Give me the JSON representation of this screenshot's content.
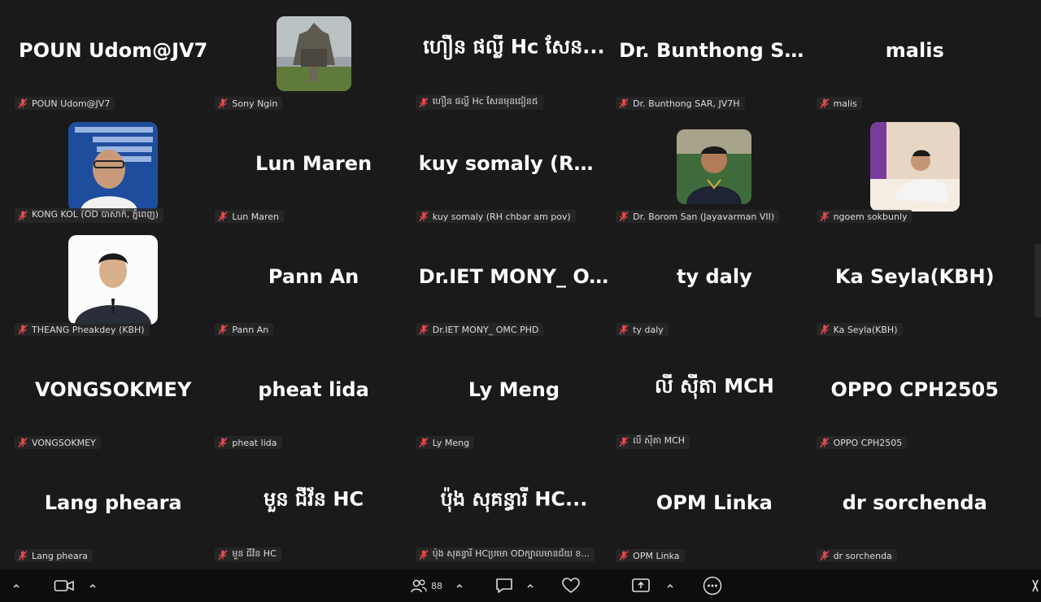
{
  "participants": [
    {
      "big": "POUN Udom@JV7",
      "label": "POUN Udom@JV7",
      "avatar": null
    },
    {
      "big": "",
      "label": "Sony Ngin",
      "avatar": "temple"
    },
    {
      "big": "ហឿន ផល្លី Hc សែន...",
      "label": "ហឿន ផល្លី Hc សែនមុនជៀន៥",
      "avatar": null
    },
    {
      "big": "Dr. Bunthong SA...",
      "label": "Dr. Bunthong SAR, JV7H",
      "avatar": null
    },
    {
      "big": "malis",
      "label": "malis",
      "avatar": null
    },
    {
      "big": "",
      "label": "KONG KOL (OD បាសាក់, ភ្នំពេញ)",
      "avatar": "presenter"
    },
    {
      "big": "Lun Maren",
      "label": "Lun Maren",
      "avatar": null
    },
    {
      "big": "kuy somaly (RH...",
      "label": "kuy somaly (RH chbar am pov)",
      "avatar": null
    },
    {
      "big": "",
      "label": "Dr. Borom San (Jayavarman VII)",
      "avatar": "man-green"
    },
    {
      "big": "",
      "label": "ngoem sokbunly",
      "avatar": "man-bed"
    },
    {
      "big": "",
      "label": "THEANG Pheakdey (KBH)",
      "avatar": "man-suit"
    },
    {
      "big": "Pann An",
      "label": "Pann An",
      "avatar": null
    },
    {
      "big": "Dr.IET MONY_ O...",
      "label": "Dr.IET MONY_ OMC PHD",
      "avatar": null
    },
    {
      "big": "ty daly",
      "label": "ty daly",
      "avatar": null
    },
    {
      "big": "Ka Seyla(KBH)",
      "label": "Ka Seyla(KBH)",
      "avatar": null
    },
    {
      "big": "VONGSOKMEY",
      "label": "VONGSOKMEY",
      "avatar": null
    },
    {
      "big": "pheat lida",
      "label": "pheat lida",
      "avatar": null
    },
    {
      "big": "Ly Meng",
      "label": "Ly Meng",
      "avatar": null
    },
    {
      "big": "លី ស៊ីតា MCH",
      "label": "លី ស៊ីតា MCH",
      "avatar": null
    },
    {
      "big": "OPPO CPH2505",
      "label": "OPPO CPH2505",
      "avatar": null
    },
    {
      "big": "Lang pheara",
      "label": "Lang pheara",
      "avatar": null
    },
    {
      "big": "មួន ជីវ័ន HC",
      "label": "មួន ជីវ័ន HC",
      "avatar": null
    },
    {
      "big": "ប៉ុង សុគន្ធារី HC...",
      "label": "ប៉ុង សុគន្ធារី HCប្រមោ ODក្បាលមានជ័យ ខ...",
      "avatar": null
    },
    {
      "big": "OPM Linka",
      "label": "OPM Linka",
      "avatar": null
    },
    {
      "big": "dr sorchenda",
      "label": "dr sorchenda",
      "avatar": null
    }
  ],
  "toolbar": {
    "participants_count": "88"
  },
  "colors": {
    "background": "#1a1a1a",
    "toolbar": "#0d0d0d",
    "mute_icon": "#e5484d"
  }
}
